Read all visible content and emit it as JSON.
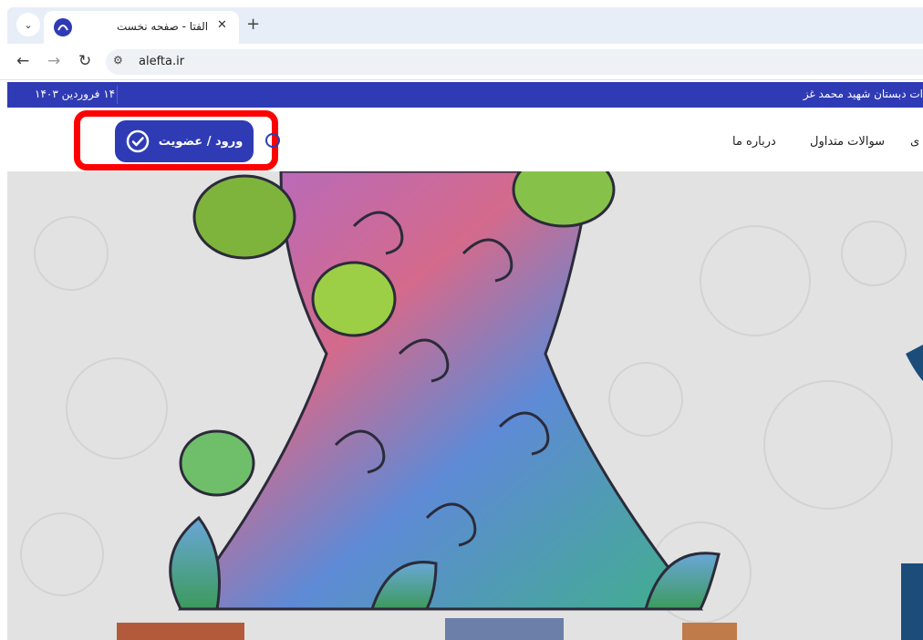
{
  "browser": {
    "tab_title": "الفتا - صفحه نخست",
    "url": "alefta.ir",
    "icons": {
      "tab_dropdown": "chevron-down-icon",
      "favicon": "alefta-logo-icon",
      "close": "close-icon",
      "new_tab": "plus-icon",
      "back": "back-arrow-icon",
      "forward": "forward-arrow-icon",
      "reload": "reload-icon",
      "site_info": "site-info-icon"
    }
  },
  "topbar": {
    "date": "۱۴ فروردین ۱۴۰۳",
    "ticker": "ات دبستان شهید محمد غز"
  },
  "header": {
    "login_label": "ورود / عضویت",
    "menu": [
      "درباره ما",
      "سوالات متداول",
      "ی"
    ]
  },
  "colors": {
    "brand_blue": "#2f3bb5",
    "highlight": "#ff0000"
  }
}
